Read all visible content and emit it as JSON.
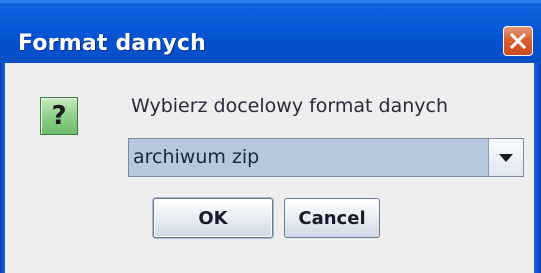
{
  "window": {
    "title": "Format danych"
  },
  "dialog": {
    "icon": "question-icon",
    "icon_glyph": "?",
    "prompt": "Wybierz docelowy format danych",
    "format_select": {
      "selected": "archiwum zip"
    },
    "buttons": {
      "ok_label": "OK",
      "cancel_label": "Cancel"
    }
  },
  "colors": {
    "titlebar": "#0a5ad8",
    "close_button": "#d9602f",
    "dialog_background": "#eeeeee",
    "icon_background": "#8fd08a",
    "combo_background": "#b8c8dc"
  }
}
